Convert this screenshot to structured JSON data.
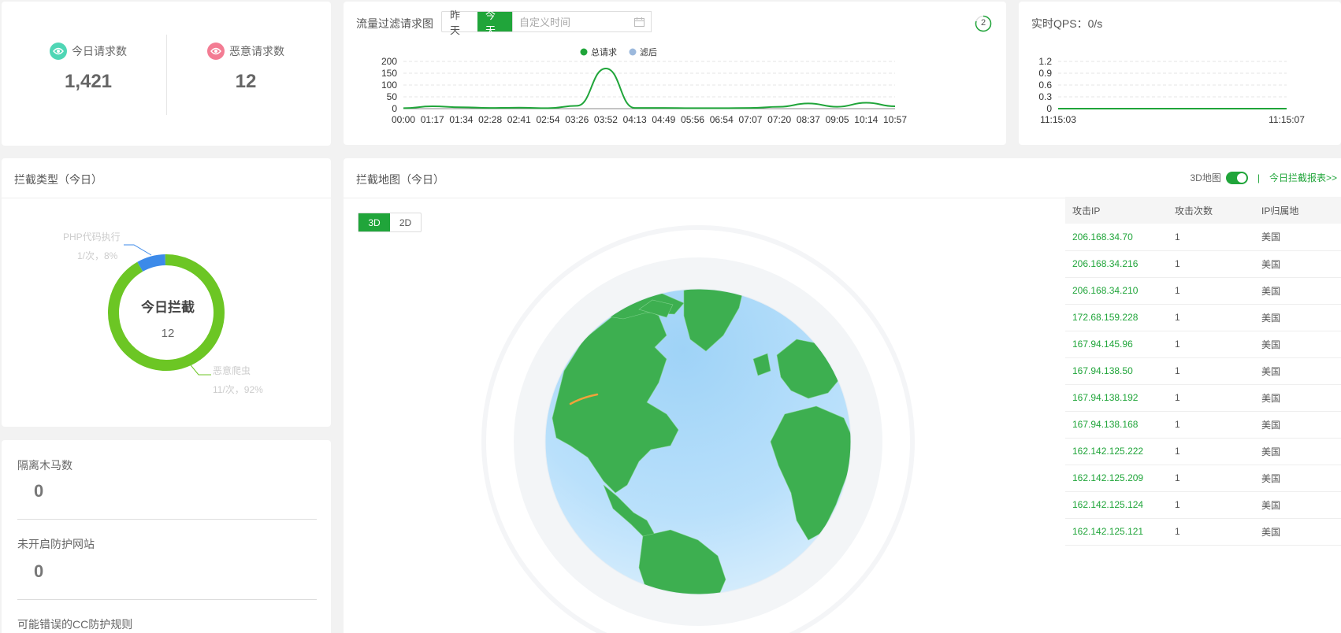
{
  "stats": {
    "today_requests_label": "今日请求数",
    "today_requests_value": "1,421",
    "malicious_requests_label": "恶意请求数",
    "malicious_requests_value": "12",
    "eye_icon": "eye-icon",
    "today_color": "#4fd6b5",
    "malicious_color": "#f37c93"
  },
  "traffic": {
    "title": "流量过滤请求图",
    "range_options": [
      "昨天",
      "今天"
    ],
    "active_range": "今天",
    "custom_time_placeholder": "自定义时间",
    "refresh_count": "2",
    "legend": [
      {
        "name": "总请求",
        "color": "#20a53a"
      },
      {
        "name": "滤后",
        "color": "#9cb9dd"
      }
    ]
  },
  "qps": {
    "title": "实时QPS：0/s"
  },
  "intercept_type": {
    "title": "拦截类型（今日）",
    "center_title": "今日拦截",
    "center_value": "12",
    "slices": [
      {
        "name": "PHP代码执行",
        "detail": "1/次，8%",
        "color": "#3c8ae9"
      },
      {
        "name": "恶意爬虫",
        "detail": "11/次，92%",
        "color": "#6cc624"
      }
    ]
  },
  "counters": [
    {
      "label": "隔离木马数",
      "value": "0"
    },
    {
      "label": "未开启防护网站",
      "value": "0"
    },
    {
      "label": "可能错误的CC防护规则",
      "value": ""
    }
  ],
  "map": {
    "title": "拦截地图（今日）",
    "map_3d_label": "3D地图",
    "report_link": "今日拦截报表>>",
    "view_modes": [
      "3D",
      "2D"
    ],
    "active_view": "3D",
    "columns": [
      "攻击IP",
      "攻击次数",
      "IP归属地"
    ],
    "rows": [
      {
        "ip": "206.168.34.70",
        "count": "1",
        "loc": "美国"
      },
      {
        "ip": "206.168.34.216",
        "count": "1",
        "loc": "美国"
      },
      {
        "ip": "206.168.34.210",
        "count": "1",
        "loc": "美国"
      },
      {
        "ip": "172.68.159.228",
        "count": "1",
        "loc": "美国"
      },
      {
        "ip": "167.94.145.96",
        "count": "1",
        "loc": "美国"
      },
      {
        "ip": "167.94.138.50",
        "count": "1",
        "loc": "美国"
      },
      {
        "ip": "167.94.138.192",
        "count": "1",
        "loc": "美国"
      },
      {
        "ip": "167.94.138.168",
        "count": "1",
        "loc": "美国"
      },
      {
        "ip": "162.142.125.222",
        "count": "1",
        "loc": "美国"
      },
      {
        "ip": "162.142.125.209",
        "count": "1",
        "loc": "美国"
      },
      {
        "ip": "162.142.125.124",
        "count": "1",
        "loc": "美国"
      },
      {
        "ip": "162.142.125.121",
        "count": "1",
        "loc": "美国"
      }
    ]
  },
  "chart_data": [
    {
      "type": "line",
      "title": "",
      "x": [
        "00:00",
        "01:17",
        "01:34",
        "02:28",
        "02:41",
        "02:54",
        "03:26",
        "03:52",
        "04:13",
        "04:49",
        "05:56",
        "06:54",
        "07:07",
        "07:20",
        "08:37",
        "09:05",
        "10:14",
        "10:57"
      ],
      "ylim": [
        0,
        200
      ],
      "yticks": [
        0,
        50,
        100,
        150,
        200
      ],
      "series": [
        {
          "name": "总请求",
          "values": [
            2,
            10,
            6,
            3,
            4,
            2,
            12,
            170,
            3,
            3,
            2,
            2,
            3,
            8,
            22,
            8,
            25,
            10
          ]
        },
        {
          "name": "滤后",
          "values": [
            2,
            10,
            6,
            3,
            4,
            2,
            12,
            170,
            3,
            3,
            2,
            2,
            3,
            8,
            22,
            8,
            25,
            10
          ]
        }
      ],
      "grid": true,
      "legend": "top-center"
    },
    {
      "type": "line",
      "title": "",
      "x": [
        "11:15:03",
        "11:15:07"
      ],
      "ylim": [
        0,
        1.2
      ],
      "yticks": [
        0,
        0.3,
        0.6,
        0.9,
        1.2
      ],
      "series": [
        {
          "name": "",
          "values": [
            0,
            0
          ]
        }
      ],
      "grid": true
    }
  ]
}
